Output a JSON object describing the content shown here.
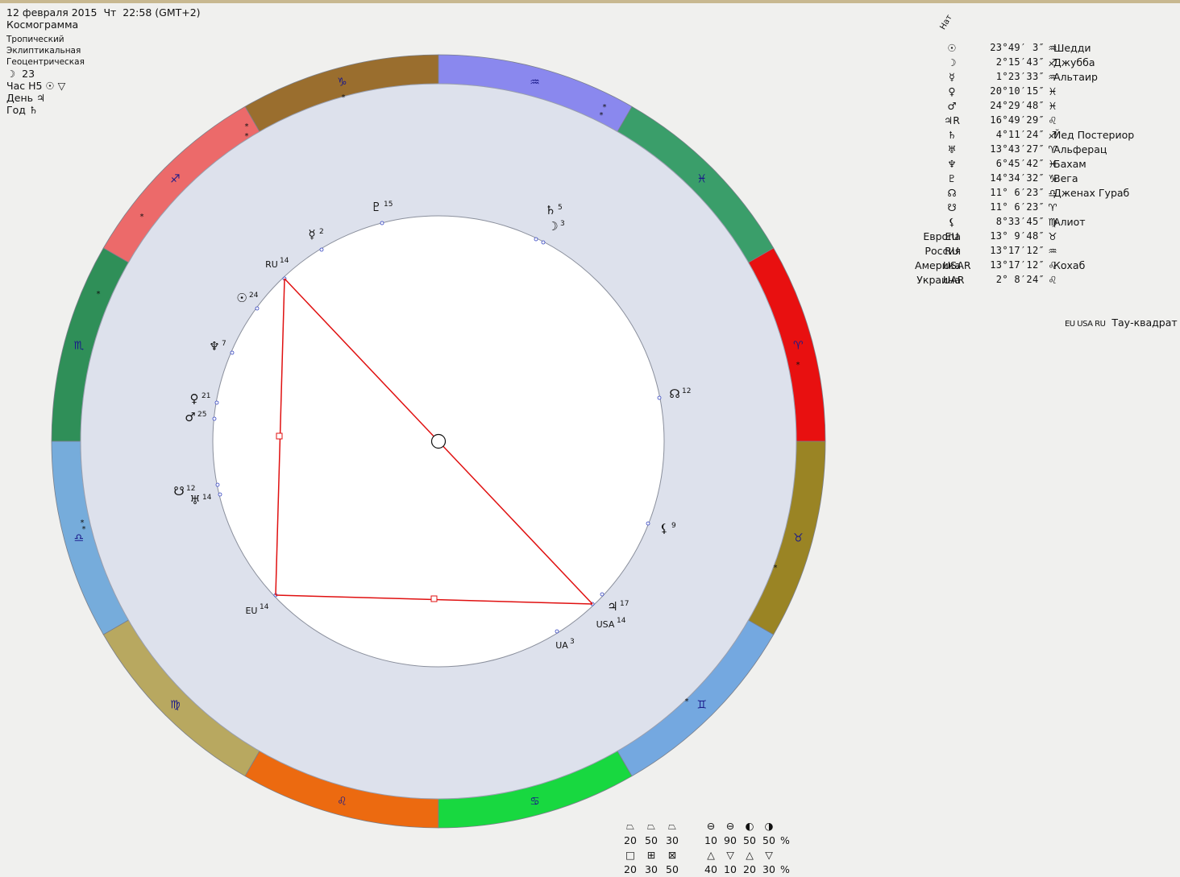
{
  "header": {
    "datetime": "12 февраля 2015  Чт  22:58 (GMT+2)",
    "chart_type": "Космограмма",
    "zodiac": "Тропический",
    "coords": "Эклиптикальная",
    "center": "Геоцентрическая",
    "moon_day": "☽  23",
    "hour": "Час Н5 ☉ ▽",
    "day": "День ♃",
    "year": "Год ♄"
  },
  "nat_label": "Нат",
  "positions": [
    {
      "label": "",
      "symbol": "☉",
      "position": "23°49′ 3″",
      "sign": "♒",
      "star": "Шедди"
    },
    {
      "label": "",
      "symbol": "☽",
      "position": "2°15′43″",
      "sign": "♐",
      "star": "Джубба"
    },
    {
      "label": "",
      "symbol": "☿",
      "position": "1°23′33″",
      "sign": "♒",
      "star": "Альтаир"
    },
    {
      "label": "",
      "symbol": "♀",
      "position": "20°10′15″",
      "sign": "♓",
      "star": ""
    },
    {
      "label": "",
      "symbol": "♂",
      "position": "24°29′48″",
      "sign": "♓",
      "star": ""
    },
    {
      "label": "",
      "symbol": "♃R",
      "position": "16°49′29″",
      "sign": "♌",
      "star": ""
    },
    {
      "label": "",
      "symbol": "♄",
      "position": "4°11′24″",
      "sign": "♐",
      "star": "Йед Постериор"
    },
    {
      "label": "",
      "symbol": "♅",
      "position": "13°43′27″",
      "sign": "♈",
      "star": "Альферац"
    },
    {
      "label": "",
      "symbol": "♆",
      "position": "6°45′42″",
      "sign": "♓",
      "star": "Бахам"
    },
    {
      "label": "",
      "symbol": "♇",
      "position": "14°34′32″",
      "sign": "♑",
      "star": "Вега"
    },
    {
      "label": "",
      "symbol": "☊",
      "position": "11° 6′23″",
      "sign": "♎",
      "star": "Дженах Гураб"
    },
    {
      "label": "",
      "symbol": "☋",
      "position": "11° 6′23″",
      "sign": "♈",
      "star": ""
    },
    {
      "label": "",
      "symbol": "⚸",
      "position": "8°33′45″",
      "sign": "♍",
      "star": "Алиот"
    },
    {
      "label": "Европа",
      "symbol": "EU",
      "position": "13° 9′48″",
      "sign": "♉",
      "star": ""
    },
    {
      "label": "Россия",
      "symbol": "RU",
      "position": "13°17′12″",
      "sign": "♒",
      "star": ""
    },
    {
      "label": "Америка",
      "symbol": "USAR",
      "position": "13°17′12″",
      "sign": "♌",
      "star": "Кохаб"
    },
    {
      "label": "Украина",
      "symbol": "UAR",
      "position": "2° 8′24″",
      "sign": "♌",
      "star": ""
    }
  ],
  "configuration": {
    "symbols": "EU USA RU",
    "name": "Тау-квадрат"
  },
  "stats": {
    "row1_icons": [
      "⏢",
      "⏢",
      "⏢",
      "",
      "⊖",
      "⊖",
      "◐",
      "◑"
    ],
    "row1_values": [
      "20",
      "50",
      "30",
      "",
      "10",
      "90",
      "50",
      "50",
      "%"
    ],
    "row2_icons": [
      "□",
      "⊞",
      "⊠",
      "",
      "△",
      "▽",
      "△",
      "▽"
    ],
    "row2_values": [
      "20",
      "30",
      "50",
      "",
      "40",
      "10",
      "20",
      "30",
      "%"
    ]
  },
  "zodiac_ring": [
    {
      "glyph": "♑",
      "color": "#9a6e2e"
    },
    {
      "glyph": "♐",
      "color": "#ec6a6a"
    },
    {
      "glyph": "♏",
      "color": "#2f8f58"
    },
    {
      "glyph": "♎",
      "color": "#76acdb"
    },
    {
      "glyph": "♍",
      "color": "#b8a860"
    },
    {
      "glyph": "♌",
      "color": "#ec6a10"
    },
    {
      "glyph": "♋",
      "color": "#18d840"
    },
    {
      "glyph": "♊",
      "color": "#74a8e0"
    },
    {
      "glyph": "♉",
      "color": "#9a8424"
    },
    {
      "glyph": "♈",
      "color": "#e81010"
    },
    {
      "glyph": "♓",
      "color": "#3a9e6a"
    },
    {
      "glyph": "♒",
      "color": "#8a88ee"
    }
  ],
  "planet_labels": [
    {
      "glyph": "♇",
      "deg": "15"
    },
    {
      "glyph": "♄",
      "deg": "5"
    },
    {
      "glyph": "☽",
      "deg": "3"
    },
    {
      "glyph": "☿",
      "deg": "2"
    },
    {
      "glyph": "RU",
      "deg": "14"
    },
    {
      "glyph": "☉",
      "deg": "24"
    },
    {
      "glyph": "♆",
      "deg": "7"
    },
    {
      "glyph": "♀",
      "deg": "21"
    },
    {
      "glyph": "♂",
      "deg": "25"
    },
    {
      "glyph": "☋",
      "deg": "12"
    },
    {
      "glyph": "♅",
      "deg": "14"
    },
    {
      "glyph": "EU",
      "deg": "14"
    },
    {
      "glyph": "☊",
      "deg": "12"
    },
    {
      "glyph": "⚸",
      "deg": "9"
    },
    {
      "glyph": "♃",
      "deg": "17"
    },
    {
      "glyph": "USA",
      "deg": "14"
    },
    {
      "glyph": "UA",
      "deg": "3"
    }
  ]
}
